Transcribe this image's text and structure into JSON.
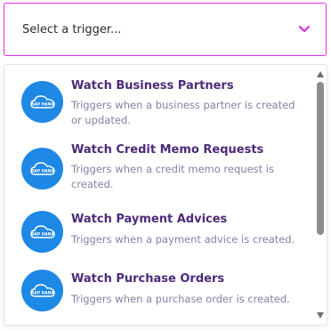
{
  "select": {
    "placeholder": "Select a trigger...",
    "accent_color": "#e02ae8"
  },
  "app": {
    "logo_icon": "sap-hana-cloud-icon",
    "logo_text": "SAP HANA",
    "logo_color": "#1e88e5"
  },
  "items": [
    {
      "title": "Watch Business Partners",
      "description": "Triggers when a business partner is created or updated."
    },
    {
      "title": "Watch Credit Memo Requests",
      "description": "Triggers when a credit memo request is created."
    },
    {
      "title": "Watch Payment Advices",
      "description": "Triggers when a payment advice is created."
    },
    {
      "title": "Watch Purchase Orders",
      "description": "Triggers when a purchase order is created."
    }
  ]
}
